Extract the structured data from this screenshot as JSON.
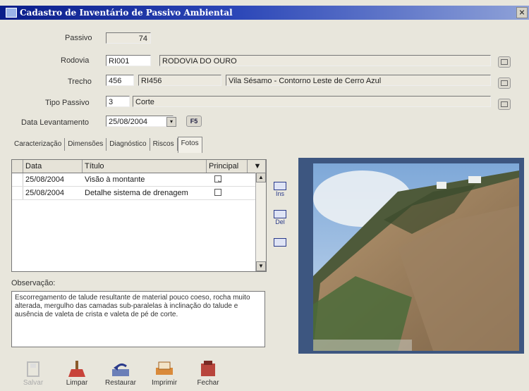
{
  "window": {
    "title": "Cadastro de Inventário de Passivo Ambiental",
    "close_label": "×"
  },
  "form": {
    "passivo": {
      "label": "Passivo",
      "value": "74"
    },
    "rodovia": {
      "label": "Rodovia",
      "code": "RI001",
      "name": "RODOVIA DO OURO"
    },
    "trecho": {
      "label": "Trecho",
      "id": "456",
      "code": "RI456",
      "name": "Vila Sésamo - Contorno Leste de Cerro Azul"
    },
    "tipo_passivo": {
      "label": "Tipo Passivo",
      "code": "3",
      "name": "Corte"
    },
    "data_levantamento": {
      "label": "Data Levantamento",
      "value": "25/08/2004",
      "f5_label": "F5"
    }
  },
  "tabs": [
    {
      "label": "Caracterização"
    },
    {
      "label": "Dimensões"
    },
    {
      "label": "Diagnóstico"
    },
    {
      "label": "Riscos"
    },
    {
      "label": "Fotos"
    }
  ],
  "photos_grid": {
    "columns": [
      "Data",
      "Título",
      "Principal"
    ],
    "rows": [
      {
        "data": "25/08/2004",
        "titulo": "Visão à montante",
        "principal": true
      },
      {
        "data": "25/08/2004",
        "titulo": "Detalhe sistema de drenagem",
        "principal": false
      }
    ]
  },
  "side_buttons": {
    "insert": "Ins",
    "delete": "Del"
  },
  "observacao": {
    "label": "Observação:",
    "text": "Escorregamento de talude resultante de material pouco coeso, rocha muito alterada, mergulho das camadas sub-paralelas à inclinação do talude e ausência de valeta de crista e valeta de pé de corte."
  },
  "toolbar": {
    "salvar": "Salvar",
    "limpar": "Limpar",
    "restaurar": "Restaurar",
    "imprimir": "Imprimir",
    "fechar": "Fechar"
  }
}
